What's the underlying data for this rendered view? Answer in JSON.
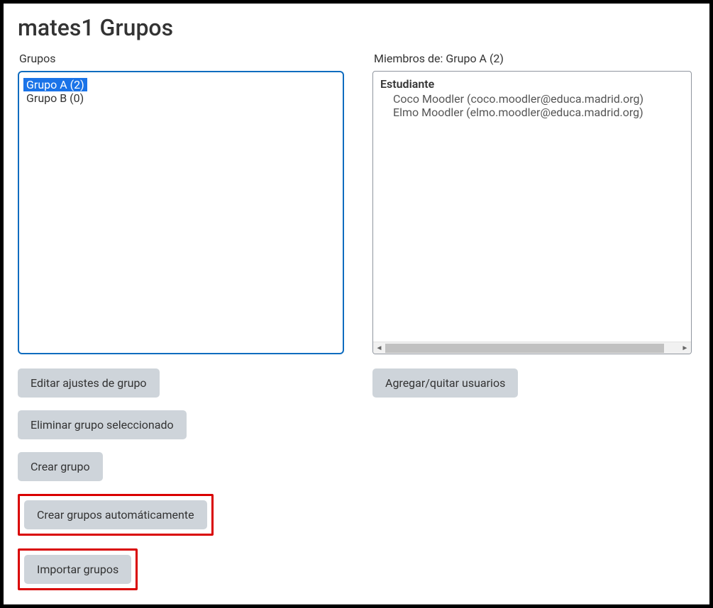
{
  "page_title": "mates1 Grupos",
  "left": {
    "label": "Grupos",
    "options": [
      {
        "text": "Grupo A (2)",
        "selected": true
      },
      {
        "text": "Grupo B (0)",
        "selected": false
      }
    ],
    "buttons": {
      "edit_settings": "Editar ajustes de grupo",
      "delete_selected": "Eliminar grupo seleccionado",
      "create_group": "Crear grupo",
      "auto_create": "Crear grupos automáticamente",
      "import_groups": "Importar grupos"
    }
  },
  "right": {
    "label": "Miembros de: Grupo A (2)",
    "role_label": "Estudiante",
    "members": [
      "Coco Moodler (coco.moodler@educa.madrid.org)",
      "Elmo Moodler (elmo.moodler@educa.madrid.org)"
    ],
    "buttons": {
      "add_remove": "Agregar/quitar usuarios"
    }
  }
}
